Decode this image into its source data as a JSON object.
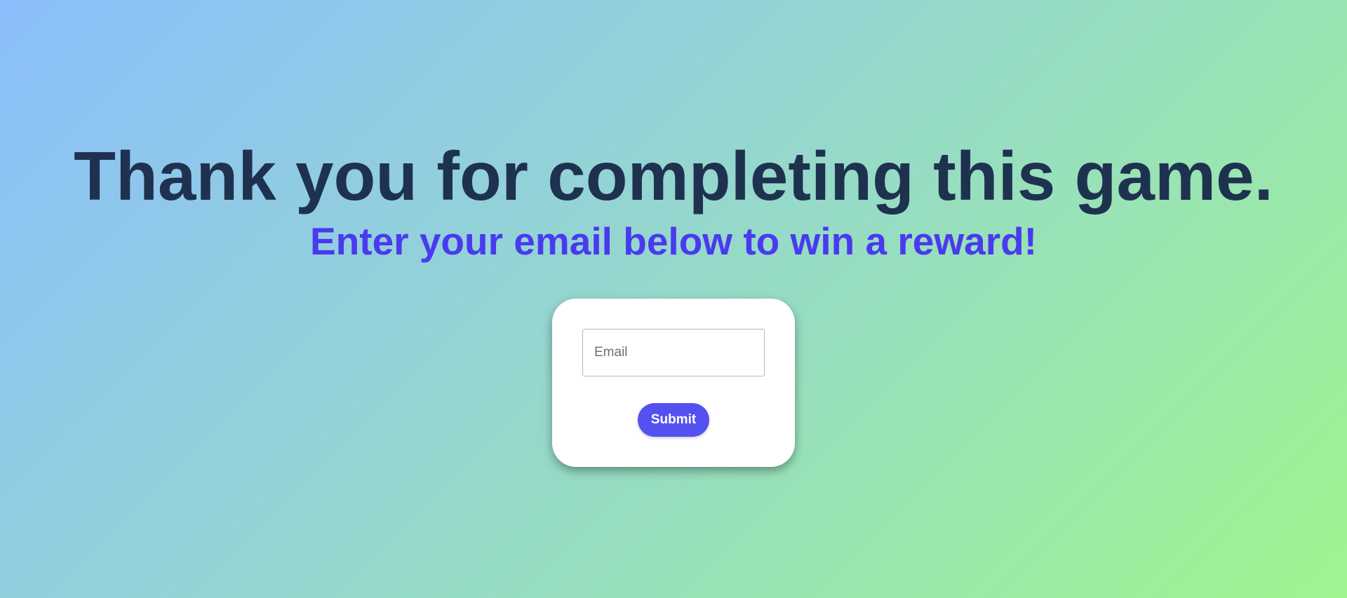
{
  "page": {
    "headline": "Thank you for completing this game.",
    "subheadline": "Enter your email below to win a reward!"
  },
  "form": {
    "email_placeholder": "Email",
    "email_value": "",
    "submit_label": "Submit"
  },
  "colors": {
    "headline": "#1e3250",
    "subheadline": "#4a3aef",
    "button": "#5550f0",
    "card": "#ffffff",
    "background_start": "#8bbefc",
    "background_end": "#9ef58f"
  }
}
